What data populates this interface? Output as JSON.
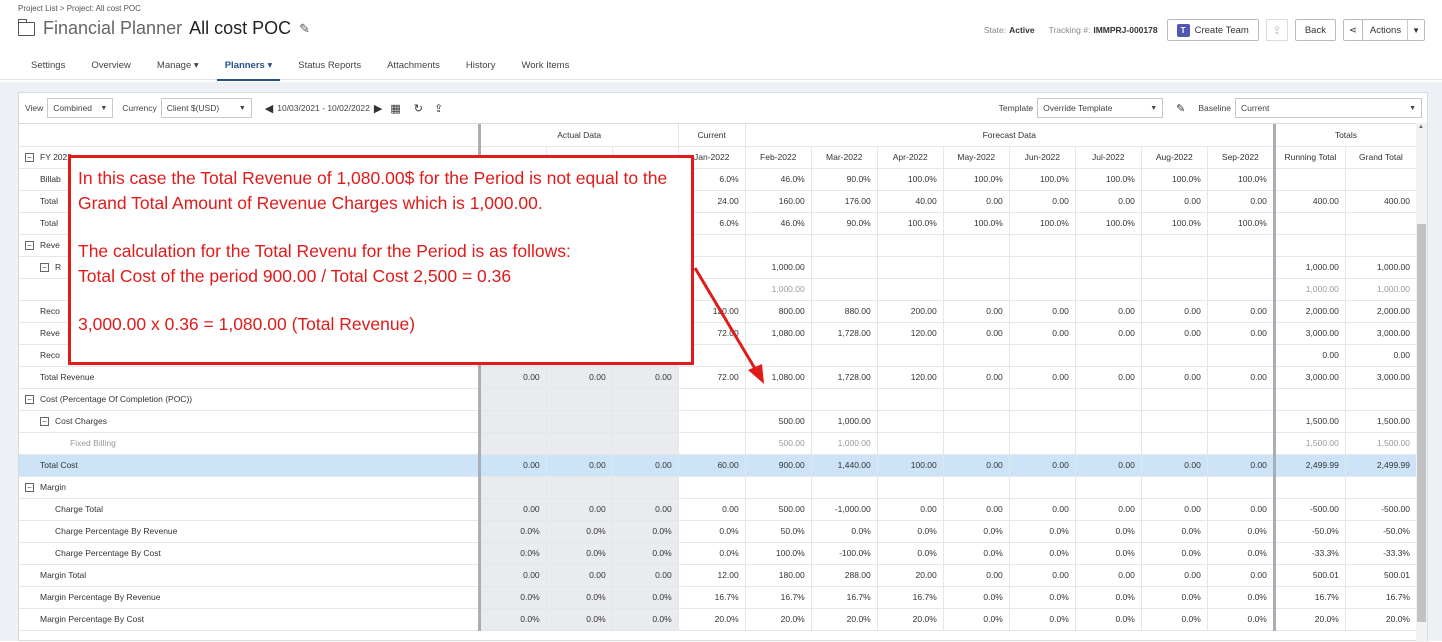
{
  "breadcrumb": "Project List > Project: All cost POC",
  "header": {
    "app_title": "Financial Planner",
    "project_title": "All cost POC",
    "state_label": "State:",
    "state_value": "Active",
    "tracking_label": "Tracking #:",
    "tracking_value": "IMMPRJ-000178",
    "create_team": "Create Team",
    "back": "Back",
    "actions": "Actions"
  },
  "tabs": [
    "Settings",
    "Overview",
    "Manage",
    "Planners",
    "Status Reports",
    "Attachments",
    "History",
    "Work Items"
  ],
  "toolbar": {
    "view_label": "View",
    "view_value": "Combined",
    "currency_label": "Currency",
    "currency_value": "Client $(USD)",
    "date_range": "10/03/2021 - 10/02/2022",
    "template_label": "Template",
    "template_value": "Override Template",
    "baseline_label": "Baseline",
    "baseline_value": "Current"
  },
  "grid": {
    "group_headers": {
      "actual": "Actual Data",
      "current": "Current",
      "forecast": "Forecast Data",
      "totals": "Totals"
    },
    "fy_label": "FY 2022",
    "columns": [
      "",
      "",
      "",
      "Jan-2022",
      "Feb-2022",
      "Mar-2022",
      "Apr-2022",
      "May-2022",
      "Jun-2022",
      "Jul-2022",
      "Aug-2022",
      "Sep-2022",
      "Running Total",
      "Grand Total"
    ],
    "rows": [
      {
        "label": "Billab",
        "indent": 1,
        "toggle": "",
        "cells": [
          "",
          "",
          "",
          "6.0%",
          "46.0%",
          "90.0%",
          "100.0%",
          "100.0%",
          "100.0%",
          "100.0%",
          "100.0%",
          "100.0%",
          "",
          ""
        ]
      },
      {
        "label": "Total",
        "indent": 1,
        "toggle": "",
        "cells": [
          "",
          "",
          "",
          "24.00",
          "160.00",
          "176.00",
          "40.00",
          "0.00",
          "0.00",
          "0.00",
          "0.00",
          "0.00",
          "400.00",
          "400.00"
        ]
      },
      {
        "label": "Total",
        "indent": 1,
        "toggle": "",
        "cells": [
          "",
          "",
          "",
          "6.0%",
          "46.0%",
          "90.0%",
          "100.0%",
          "100.0%",
          "100.0%",
          "100.0%",
          "100.0%",
          "100.0%",
          "",
          ""
        ]
      },
      {
        "label": "Reve",
        "indent": 0,
        "toggle": "−",
        "cells": [
          "",
          "",
          "",
          "",
          "",
          "",
          "",
          "",
          "",
          "",
          "",
          "",
          "",
          ""
        ]
      },
      {
        "label": "R",
        "indent": 1,
        "toggle": "−",
        "cells": [
          "",
          "",
          "",
          "",
          "1,000.00",
          "",
          "",
          "",
          "",
          "",
          "",
          "",
          "1,000.00",
          "1,000.00"
        ]
      },
      {
        "label": "",
        "indent": 2,
        "toggle": "",
        "sub": true,
        "cells": [
          "",
          "",
          "",
          "",
          "1,000.00",
          "",
          "",
          "",
          "",
          "",
          "",
          "",
          "1,000.00",
          "1,000.00"
        ]
      },
      {
        "label": "Reco",
        "indent": 1,
        "toggle": "",
        "cells": [
          "",
          "",
          "",
          "120.00",
          "800.00",
          "880.00",
          "200.00",
          "0.00",
          "0.00",
          "0.00",
          "0.00",
          "0.00",
          "2,000.00",
          "2,000.00"
        ]
      },
      {
        "label": "Reve",
        "indent": 1,
        "toggle": "",
        "cells": [
          "",
          "",
          "",
          "72.00",
          "1,080.00",
          "1,728.00",
          "120.00",
          "0.00",
          "0.00",
          "0.00",
          "0.00",
          "0.00",
          "3,000.00",
          "3,000.00"
        ]
      },
      {
        "label": "Reco",
        "indent": 1,
        "toggle": "",
        "cells": [
          "",
          "",
          "",
          "",
          "",
          "",
          "",
          "",
          "",
          "",
          "",
          "",
          "0.00",
          "0.00"
        ]
      },
      {
        "label": "Total Revenue",
        "indent": 1,
        "toggle": "",
        "cells": [
          "0.00",
          "0.00",
          "0.00",
          "72.00",
          "1,080.00",
          "1,728.00",
          "120.00",
          "0.00",
          "0.00",
          "0.00",
          "0.00",
          "0.00",
          "3,000.00",
          "3,000.00"
        ]
      },
      {
        "label": "Cost (Percentage Of Completion (POC))",
        "indent": 0,
        "toggle": "−",
        "cells": [
          "",
          "",
          "",
          "",
          "",
          "",
          "",
          "",
          "",
          "",
          "",
          "",
          "",
          ""
        ]
      },
      {
        "label": "Cost Charges",
        "indent": 1,
        "toggle": "−",
        "cells": [
          "",
          "",
          "",
          "",
          "500.00",
          "1,000.00",
          "",
          "",
          "",
          "",
          "",
          "",
          "1,500.00",
          "1,500.00"
        ]
      },
      {
        "label": "Fixed Billing",
        "indent": 3,
        "toggle": "",
        "sub": true,
        "cells": [
          "",
          "",
          "",
          "",
          "500.00",
          "1,000.00",
          "",
          "",
          "",
          "",
          "",
          "",
          "1,500.00",
          "1,500.00"
        ]
      },
      {
        "label": "Total Cost",
        "indent": 1,
        "toggle": "",
        "hl": true,
        "cells": [
          "0.00",
          "0.00",
          "0.00",
          "60.00",
          "900.00",
          "1,440.00",
          "100.00",
          "0.00",
          "0.00",
          "0.00",
          "0.00",
          "0.00",
          "2,499.99",
          "2,499.99"
        ]
      },
      {
        "label": "Margin",
        "indent": 0,
        "toggle": "−",
        "cells": [
          "",
          "",
          "",
          "",
          "",
          "",
          "",
          "",
          "",
          "",
          "",
          "",
          "",
          ""
        ]
      },
      {
        "label": "Charge Total",
        "indent": 2,
        "toggle": "",
        "cells": [
          "0.00",
          "0.00",
          "0.00",
          "0.00",
          "500.00",
          "-1,000.00",
          "0.00",
          "0.00",
          "0.00",
          "0.00",
          "0.00",
          "0.00",
          "-500.00",
          "-500.00"
        ]
      },
      {
        "label": "Charge Percentage By Revenue",
        "indent": 2,
        "toggle": "",
        "cells": [
          "0.0%",
          "0.0%",
          "0.0%",
          "0.0%",
          "50.0%",
          "0.0%",
          "0.0%",
          "0.0%",
          "0.0%",
          "0.0%",
          "0.0%",
          "0.0%",
          "-50.0%",
          "-50.0%"
        ]
      },
      {
        "label": "Charge Percentage By Cost",
        "indent": 2,
        "toggle": "",
        "cells": [
          "0.0%",
          "0.0%",
          "0.0%",
          "0.0%",
          "100.0%",
          "-100.0%",
          "0.0%",
          "0.0%",
          "0.0%",
          "0.0%",
          "0.0%",
          "0.0%",
          "-33.3%",
          "-33.3%"
        ]
      },
      {
        "label": "Margin Total",
        "indent": 1,
        "toggle": "",
        "cells": [
          "0.00",
          "0.00",
          "0.00",
          "12.00",
          "180.00",
          "288.00",
          "20.00",
          "0.00",
          "0.00",
          "0.00",
          "0.00",
          "0.00",
          "500.01",
          "500.01"
        ]
      },
      {
        "label": "Margin Percentage By Revenue",
        "indent": 1,
        "toggle": "",
        "cells": [
          "0.0%",
          "0.0%",
          "0.0%",
          "16.7%",
          "16.7%",
          "16.7%",
          "16.7%",
          "0.0%",
          "0.0%",
          "0.0%",
          "0.0%",
          "0.0%",
          "16.7%",
          "16.7%"
        ]
      },
      {
        "label": "Margin Percentage By Cost",
        "indent": 1,
        "toggle": "",
        "cells": [
          "0.0%",
          "0.0%",
          "0.0%",
          "20.0%",
          "20.0%",
          "20.0%",
          "20.0%",
          "0.0%",
          "0.0%",
          "0.0%",
          "0.0%",
          "0.0%",
          "20.0%",
          "20.0%"
        ]
      }
    ]
  },
  "callout": {
    "line1": "In this case the Total Revenue of 1,080.00$ for the Period is not equal to the Grand Total Amount of Revenue Charges which is 1,000.00.",
    "line2": "The calculation for the Total Revenu for the Period is as follows:",
    "line3": "Total Cost of the period 900.00 / Total Cost 2,500 = 0.36",
    "line4": "3,000.00 x 0.36 = 1,080.00 (Total Revenue)"
  },
  "colors": {
    "callout_red": "#e11a1a",
    "highlight_row": "#cde4f8",
    "active_tab": "#2a4f8a"
  }
}
